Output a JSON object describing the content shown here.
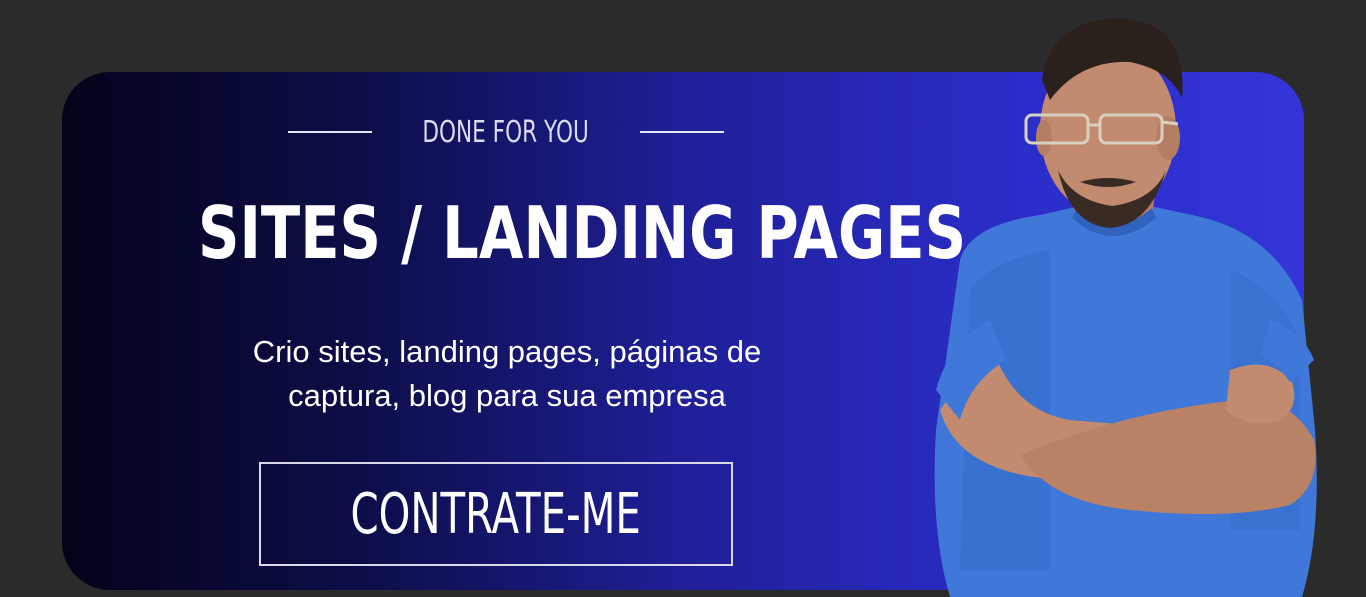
{
  "banner": {
    "eyebrow": "DONE FOR YOU",
    "title": "SITES / LANDING PAGES",
    "description_line1": "Crio sites, landing pages, páginas de",
    "description_line2": "captura, blog para sua empresa",
    "cta_label": "CONTRATE-ME"
  },
  "colors": {
    "page_background": "#2b2b2b",
    "banner_gradient_start": "#03031a",
    "banner_gradient_end": "#3434d8",
    "shirt": "#3f78d8",
    "text": "#ffffff"
  },
  "icons": [
    "person-photo"
  ]
}
